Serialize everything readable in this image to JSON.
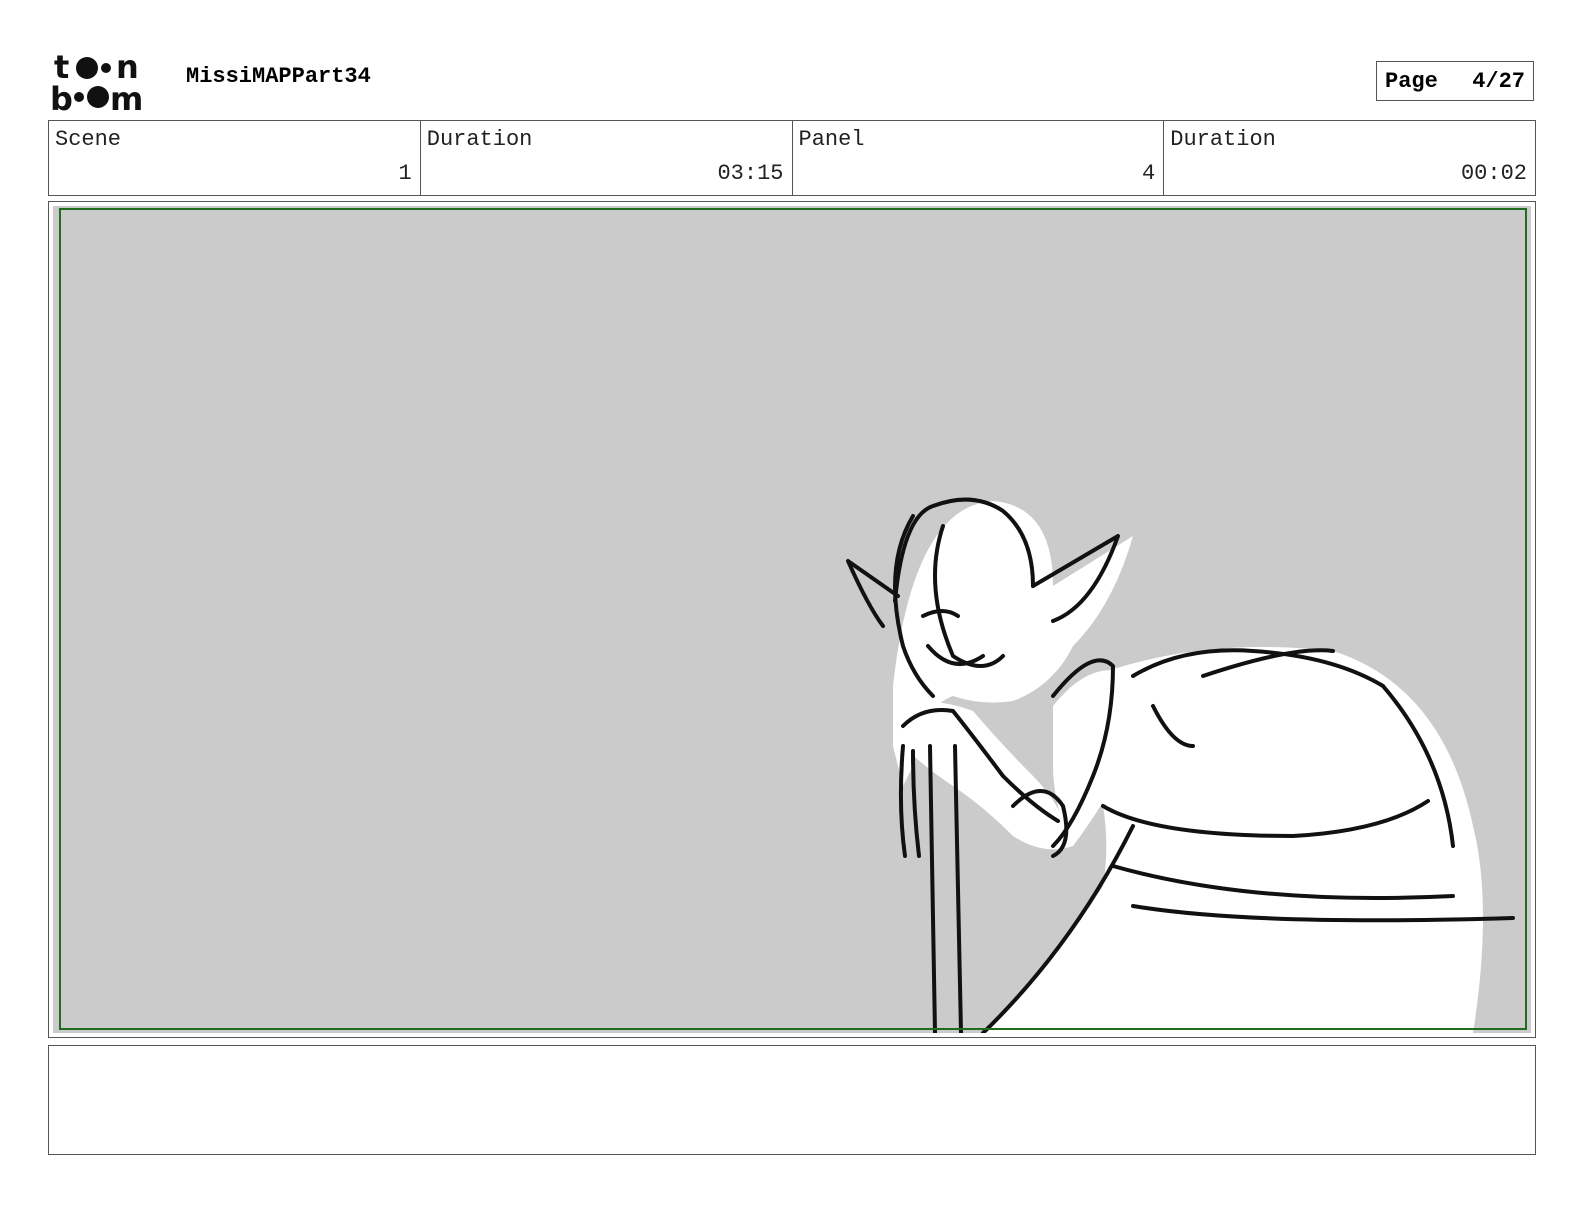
{
  "header": {
    "logo_text": "toon boom",
    "project_title": "MissiMAPPart34",
    "page_label": "Page",
    "page_number": "4/27"
  },
  "info": {
    "scene_label": "Scene",
    "scene_value": "1",
    "scene_duration_label": "Duration",
    "scene_duration_value": "03:15",
    "panel_label": "Panel",
    "panel_value": "4",
    "panel_duration_label": "Duration",
    "panel_duration_value": "00:02"
  },
  "panel": {
    "background_color": "#cbcbcb",
    "safe_area_color": "#1f6b1f"
  },
  "notes": {
    "text": ""
  }
}
